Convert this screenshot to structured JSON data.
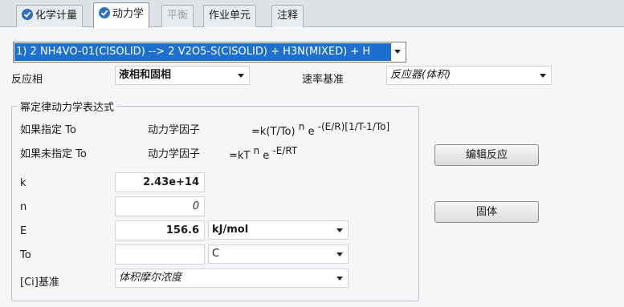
{
  "tabs": [
    {
      "label": "化学计量",
      "checked": true
    },
    {
      "label": "动力学",
      "checked": true
    },
    {
      "label": "平衡",
      "checked": false
    },
    {
      "label": "作业单元",
      "checked": false
    },
    {
      "label": "注释",
      "checked": false
    }
  ],
  "reaction": {
    "selected": "1) 2 NH4VO-01(CISOLID)   -->  2 V2O5-S(CISOLID) + H3N(MIXED) + H"
  },
  "phase": {
    "label": "反应相",
    "value": "液相和固相"
  },
  "rate_basis": {
    "label": "速率基准",
    "value": "反应器(体积)"
  },
  "group": {
    "title": "幂定律动力学表达式",
    "row1": {
      "label": "如果指定 To",
      "factor": "动力学因子",
      "eq": "=k(T/To)",
      "n": "n",
      "e": "e",
      "exp": "-(E/R)[1/T-1/To]"
    },
    "row2": {
      "label": "如果未指定 To",
      "factor": "动力学因子",
      "eq": "=kT",
      "n": "n",
      "e": "e",
      "exp": "-E/RT"
    }
  },
  "params": {
    "k": {
      "label": "k",
      "value": "2.43e+14"
    },
    "n": {
      "label": "n",
      "value": "0"
    },
    "E": {
      "label": "E",
      "value": "156.6",
      "unit": "kJ/mol"
    },
    "To": {
      "label": "To",
      "value": "",
      "unit": "C"
    },
    "Ci": {
      "label": "[Ci]基准",
      "value": "体积摩尔浓度"
    }
  },
  "buttons": {
    "edit_reaction": "编辑反应",
    "solid": "固体"
  },
  "colors": {
    "accent": "#1d6fd0",
    "check": "#2f6fc0"
  }
}
